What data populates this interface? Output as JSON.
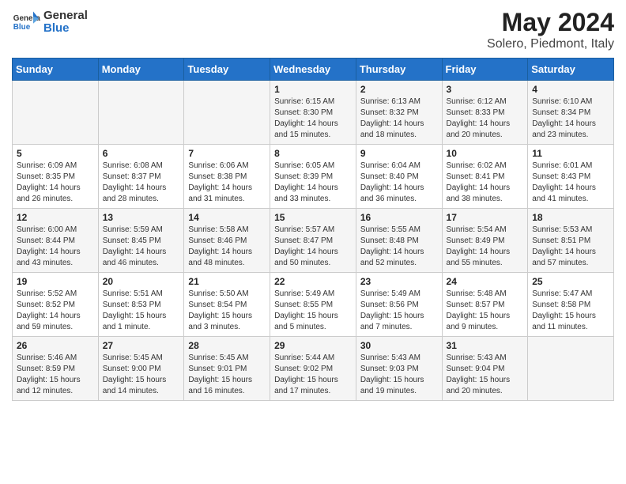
{
  "header": {
    "logo_general": "General",
    "logo_blue": "Blue",
    "title": "May 2024",
    "subtitle": "Solero, Piedmont, Italy"
  },
  "days_of_week": [
    "Sunday",
    "Monday",
    "Tuesday",
    "Wednesday",
    "Thursday",
    "Friday",
    "Saturday"
  ],
  "weeks": [
    [
      {
        "num": "",
        "info": ""
      },
      {
        "num": "",
        "info": ""
      },
      {
        "num": "",
        "info": ""
      },
      {
        "num": "1",
        "info": "Sunrise: 6:15 AM\nSunset: 8:30 PM\nDaylight: 14 hours and 15 minutes."
      },
      {
        "num": "2",
        "info": "Sunrise: 6:13 AM\nSunset: 8:32 PM\nDaylight: 14 hours and 18 minutes."
      },
      {
        "num": "3",
        "info": "Sunrise: 6:12 AM\nSunset: 8:33 PM\nDaylight: 14 hours and 20 minutes."
      },
      {
        "num": "4",
        "info": "Sunrise: 6:10 AM\nSunset: 8:34 PM\nDaylight: 14 hours and 23 minutes."
      }
    ],
    [
      {
        "num": "5",
        "info": "Sunrise: 6:09 AM\nSunset: 8:35 PM\nDaylight: 14 hours and 26 minutes."
      },
      {
        "num": "6",
        "info": "Sunrise: 6:08 AM\nSunset: 8:37 PM\nDaylight: 14 hours and 28 minutes."
      },
      {
        "num": "7",
        "info": "Sunrise: 6:06 AM\nSunset: 8:38 PM\nDaylight: 14 hours and 31 minutes."
      },
      {
        "num": "8",
        "info": "Sunrise: 6:05 AM\nSunset: 8:39 PM\nDaylight: 14 hours and 33 minutes."
      },
      {
        "num": "9",
        "info": "Sunrise: 6:04 AM\nSunset: 8:40 PM\nDaylight: 14 hours and 36 minutes."
      },
      {
        "num": "10",
        "info": "Sunrise: 6:02 AM\nSunset: 8:41 PM\nDaylight: 14 hours and 38 minutes."
      },
      {
        "num": "11",
        "info": "Sunrise: 6:01 AM\nSunset: 8:43 PM\nDaylight: 14 hours and 41 minutes."
      }
    ],
    [
      {
        "num": "12",
        "info": "Sunrise: 6:00 AM\nSunset: 8:44 PM\nDaylight: 14 hours and 43 minutes."
      },
      {
        "num": "13",
        "info": "Sunrise: 5:59 AM\nSunset: 8:45 PM\nDaylight: 14 hours and 46 minutes."
      },
      {
        "num": "14",
        "info": "Sunrise: 5:58 AM\nSunset: 8:46 PM\nDaylight: 14 hours and 48 minutes."
      },
      {
        "num": "15",
        "info": "Sunrise: 5:57 AM\nSunset: 8:47 PM\nDaylight: 14 hours and 50 minutes."
      },
      {
        "num": "16",
        "info": "Sunrise: 5:55 AM\nSunset: 8:48 PM\nDaylight: 14 hours and 52 minutes."
      },
      {
        "num": "17",
        "info": "Sunrise: 5:54 AM\nSunset: 8:49 PM\nDaylight: 14 hours and 55 minutes."
      },
      {
        "num": "18",
        "info": "Sunrise: 5:53 AM\nSunset: 8:51 PM\nDaylight: 14 hours and 57 minutes."
      }
    ],
    [
      {
        "num": "19",
        "info": "Sunrise: 5:52 AM\nSunset: 8:52 PM\nDaylight: 14 hours and 59 minutes."
      },
      {
        "num": "20",
        "info": "Sunrise: 5:51 AM\nSunset: 8:53 PM\nDaylight: 15 hours and 1 minute."
      },
      {
        "num": "21",
        "info": "Sunrise: 5:50 AM\nSunset: 8:54 PM\nDaylight: 15 hours and 3 minutes."
      },
      {
        "num": "22",
        "info": "Sunrise: 5:49 AM\nSunset: 8:55 PM\nDaylight: 15 hours and 5 minutes."
      },
      {
        "num": "23",
        "info": "Sunrise: 5:49 AM\nSunset: 8:56 PM\nDaylight: 15 hours and 7 minutes."
      },
      {
        "num": "24",
        "info": "Sunrise: 5:48 AM\nSunset: 8:57 PM\nDaylight: 15 hours and 9 minutes."
      },
      {
        "num": "25",
        "info": "Sunrise: 5:47 AM\nSunset: 8:58 PM\nDaylight: 15 hours and 11 minutes."
      }
    ],
    [
      {
        "num": "26",
        "info": "Sunrise: 5:46 AM\nSunset: 8:59 PM\nDaylight: 15 hours and 12 minutes."
      },
      {
        "num": "27",
        "info": "Sunrise: 5:45 AM\nSunset: 9:00 PM\nDaylight: 15 hours and 14 minutes."
      },
      {
        "num": "28",
        "info": "Sunrise: 5:45 AM\nSunset: 9:01 PM\nDaylight: 15 hours and 16 minutes."
      },
      {
        "num": "29",
        "info": "Sunrise: 5:44 AM\nSunset: 9:02 PM\nDaylight: 15 hours and 17 minutes."
      },
      {
        "num": "30",
        "info": "Sunrise: 5:43 AM\nSunset: 9:03 PM\nDaylight: 15 hours and 19 minutes."
      },
      {
        "num": "31",
        "info": "Sunrise: 5:43 AM\nSunset: 9:04 PM\nDaylight: 15 hours and 20 minutes."
      },
      {
        "num": "",
        "info": ""
      }
    ]
  ]
}
